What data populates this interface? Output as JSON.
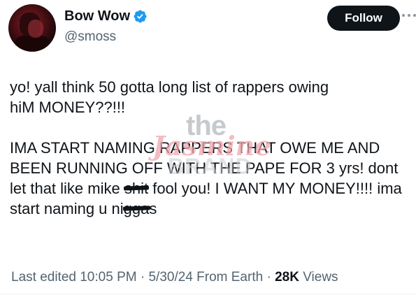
{
  "tweet": {
    "author_name": "Bow Wow",
    "author_handle": "@smoss",
    "follow_label": "Follow",
    "text_p1_line1": "yo! yall think 50 gotta  long list of rappers owing",
    "text_p1_line2": "hiM MONEY??!!!",
    "text_p2_part1": "IMA START NAMING RAPPERS THAT OWE ME AND BEEN RUNNING OFF WITH THE PAPE FOR 3 yrs! dont let that like mike ",
    "text_p2_redacted1": "shit",
    "text_p2_part2": " fool you! I WANT MY MONEY!!!! ima start naming u ni",
    "text_p2_redacted2": "gga",
    "text_p2_part3": "s"
  },
  "watermark": {
    "line1": "the",
    "line2": "Jasmine",
    "line3": "BRAND"
  },
  "meta": {
    "edited_label": "Last edited 10:05 PM",
    "sep1": " · ",
    "date": "5/30/24",
    "location": "  From Earth",
    "sep2": " · ",
    "views_count": "28K",
    "views_label": " Views"
  },
  "icons": {
    "verified": "verified-badge-icon",
    "more": "more-dots-icon"
  },
  "colors": {
    "verified_blue": "#1d9bf0",
    "button_bg": "#0f1419",
    "secondary_text": "#536471"
  }
}
